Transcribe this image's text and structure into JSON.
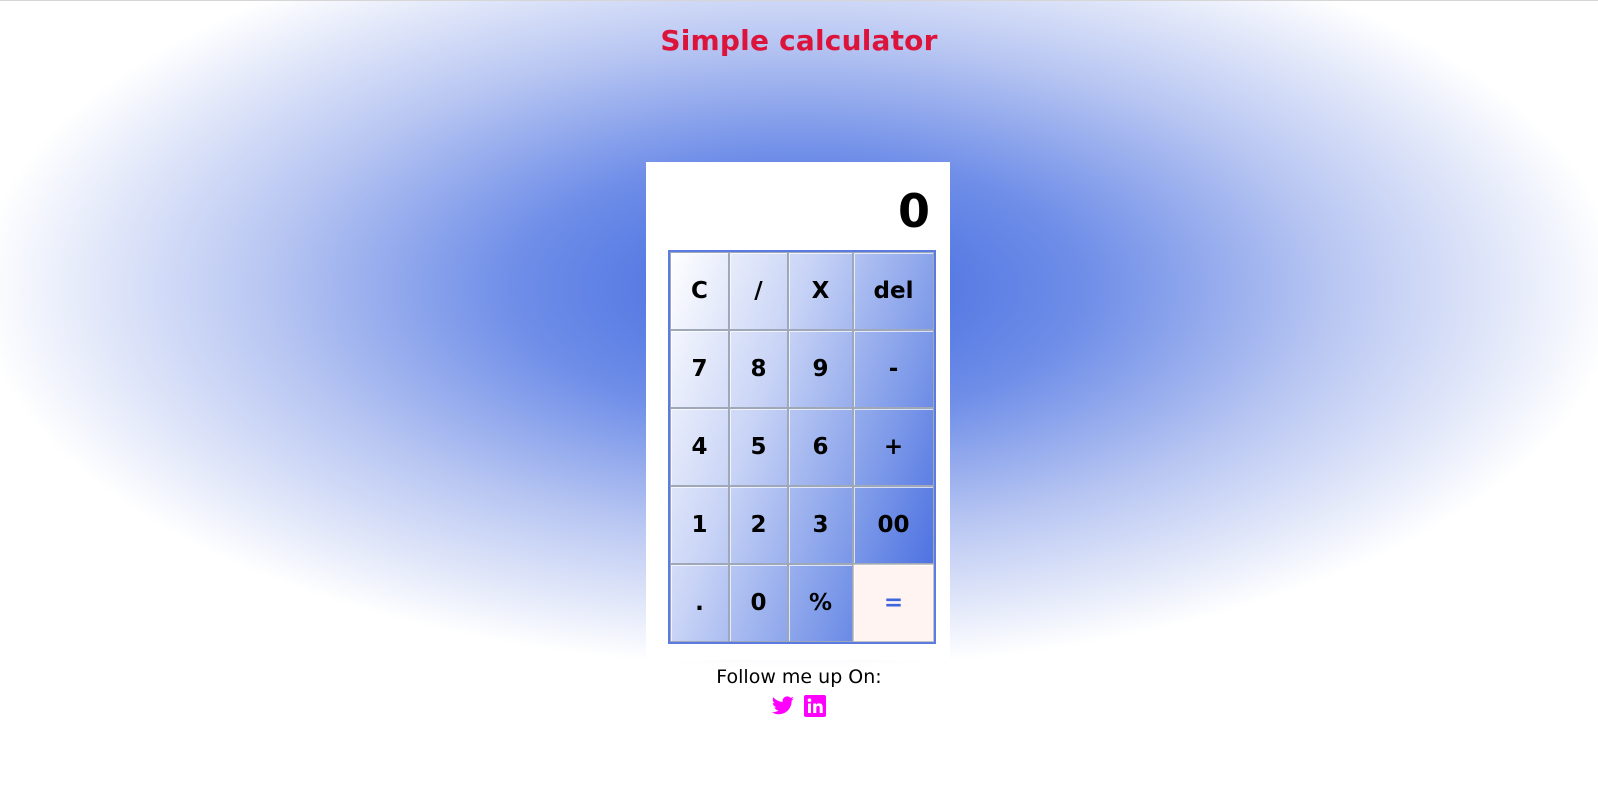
{
  "header": {
    "title": "Simple calculator"
  },
  "calculator": {
    "display_value": "0",
    "keys": [
      {
        "label": "C",
        "name": "clear-button"
      },
      {
        "label": "/",
        "name": "divide-button"
      },
      {
        "label": "X",
        "name": "multiply-button"
      },
      {
        "label": "del",
        "name": "delete-button"
      },
      {
        "label": "7",
        "name": "digit-7-button"
      },
      {
        "label": "8",
        "name": "digit-8-button"
      },
      {
        "label": "9",
        "name": "digit-9-button"
      },
      {
        "label": "-",
        "name": "subtract-button"
      },
      {
        "label": "4",
        "name": "digit-4-button"
      },
      {
        "label": "5",
        "name": "digit-5-button"
      },
      {
        "label": "6",
        "name": "digit-6-button"
      },
      {
        "label": "+",
        "name": "add-button"
      },
      {
        "label": "1",
        "name": "digit-1-button"
      },
      {
        "label": "2",
        "name": "digit-2-button"
      },
      {
        "label": "3",
        "name": "digit-3-button"
      },
      {
        "label": "00",
        "name": "double-zero-button"
      },
      {
        "label": ".",
        "name": "decimal-button"
      },
      {
        "label": "0",
        "name": "digit-0-button"
      },
      {
        "label": "%",
        "name": "percent-button"
      },
      {
        "label": "=",
        "name": "equals-button"
      }
    ]
  },
  "footer": {
    "follow_text": "Follow me up On:",
    "social_icons": [
      "twitter-icon",
      "linkedin-icon"
    ],
    "icon_color": "#ff00ff"
  },
  "colors": {
    "title": "#dc143c",
    "accent": "#3e65df",
    "equals_bg": "#fff4f2"
  }
}
